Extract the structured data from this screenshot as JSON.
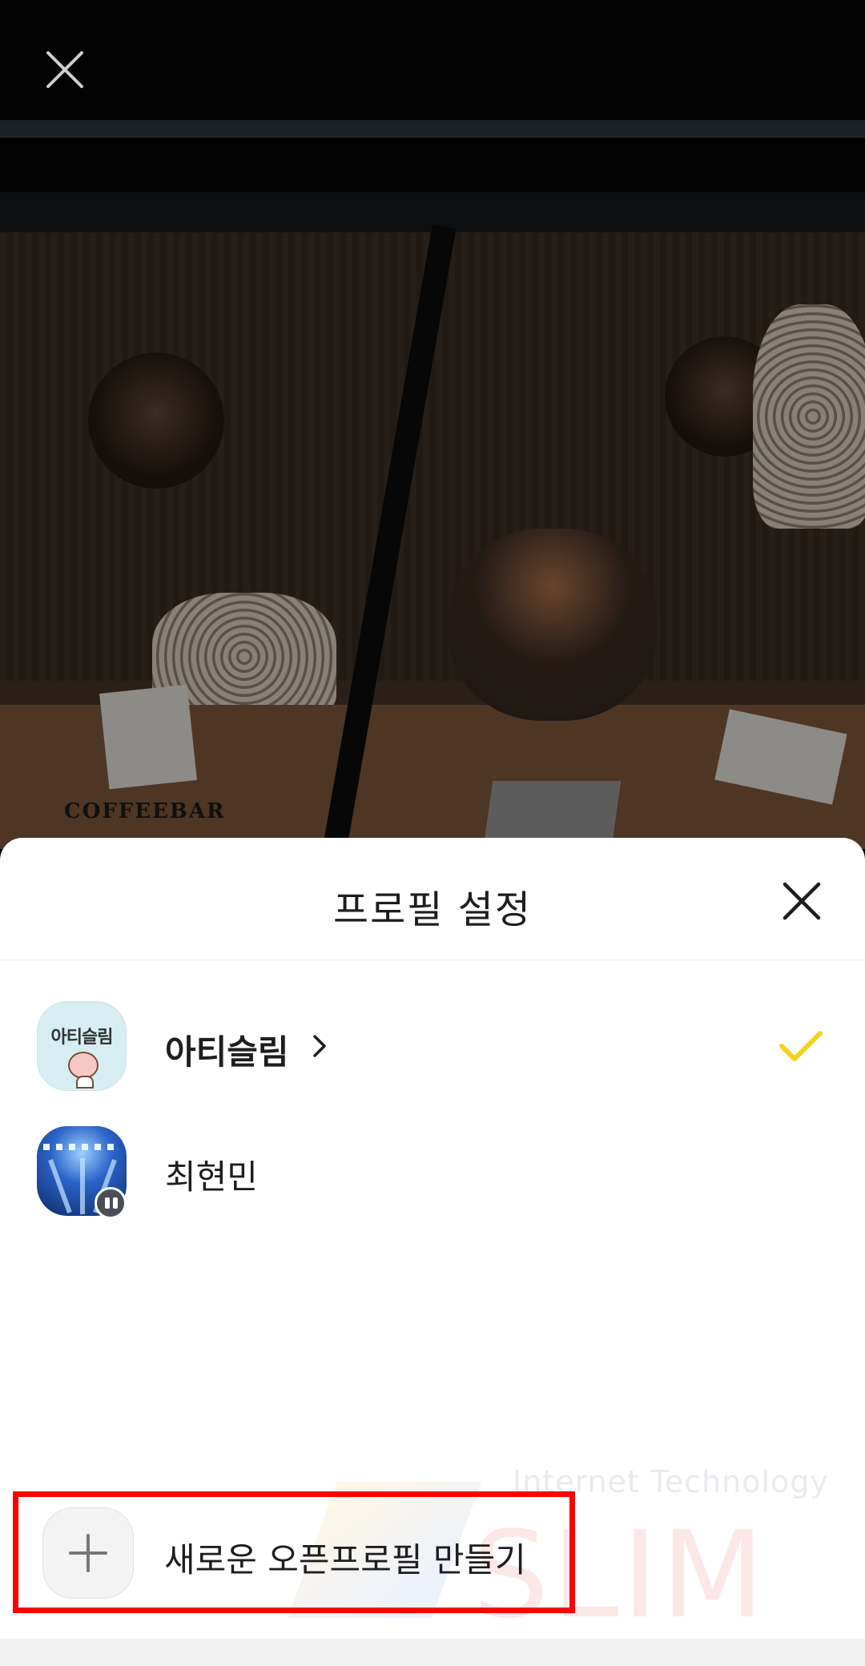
{
  "sheet": {
    "title": "프로필 설정"
  },
  "profiles": [
    {
      "name": "아티슬림",
      "avatar_text": "아티슬림",
      "selected": true
    },
    {
      "name": "최현민",
      "selected": false
    }
  ],
  "add_profile": {
    "label": "새로운 오픈프로필 만들기"
  },
  "photo": {
    "sign": "COFFEEBAR"
  },
  "watermark": {
    "sub": "Internet Technology",
    "main": "SLIM"
  },
  "colors": {
    "check": "#f5d21a",
    "highlight": "#ff0000",
    "text": "#1e1e1e"
  }
}
